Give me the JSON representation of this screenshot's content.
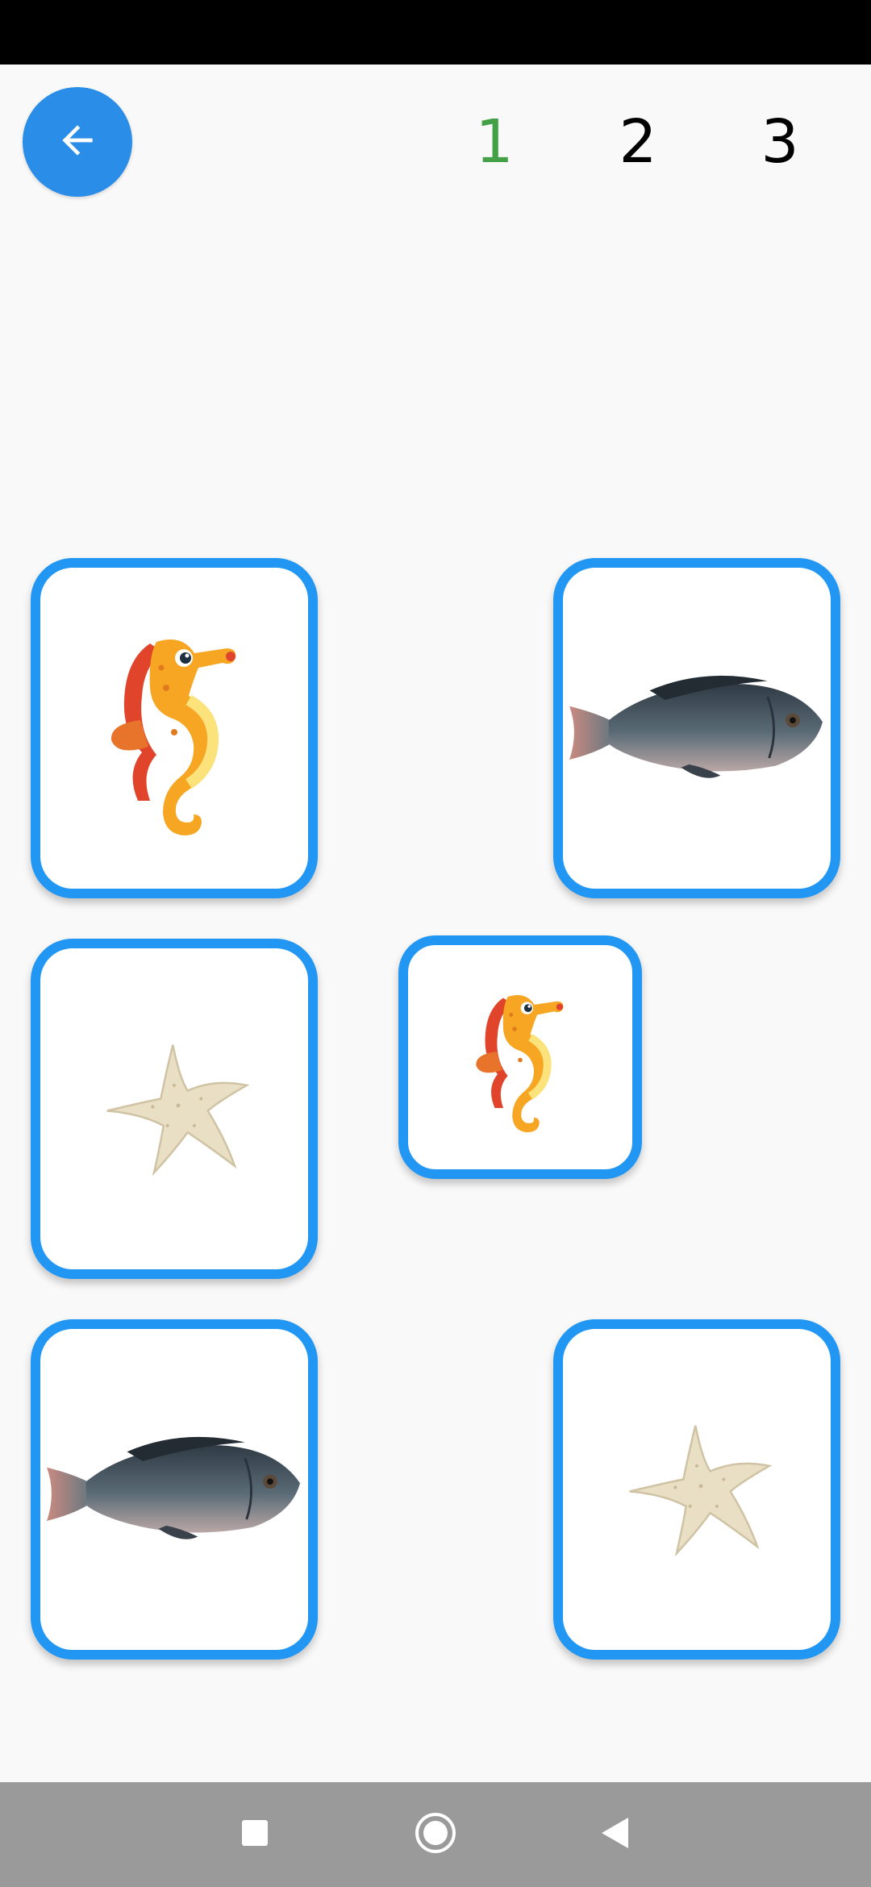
{
  "header": {
    "back_icon": "arrow-left-icon",
    "back_color": "#2a8ee8",
    "levels": [
      {
        "label": "1",
        "state": "active"
      },
      {
        "label": "2",
        "state": "inactive"
      },
      {
        "label": "3",
        "state": "inactive"
      }
    ],
    "active_color": "#43a047"
  },
  "board": {
    "card_border_color": "#2196f3",
    "cards": [
      {
        "image": "seahorse-icon",
        "size": "large"
      },
      {
        "image": "tilapia-fish-icon",
        "size": "large"
      },
      {
        "image": "starfish-icon",
        "size": "large"
      },
      {
        "image": "seahorse-icon",
        "size": "small"
      },
      {
        "image": "tilapia-fish-icon",
        "size": "large"
      },
      {
        "image": "starfish-icon",
        "size": "large"
      }
    ]
  },
  "navbar": {
    "buttons": [
      "recents-square-icon",
      "home-circle-icon",
      "back-triangle-icon"
    ]
  }
}
